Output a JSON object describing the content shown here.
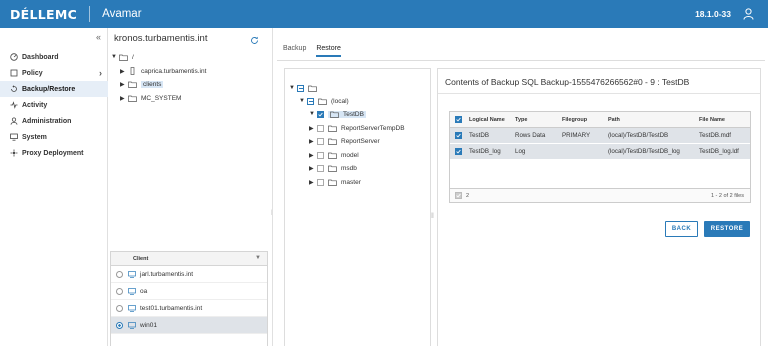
{
  "header": {
    "brand": "DÉLLEMC",
    "app_name": "Avamar",
    "version": "18.1.0-33",
    "bg_color": "#2a7ab8"
  },
  "nav": {
    "collapse_glyph": "«",
    "items": [
      {
        "label": "Dashboard",
        "icon": "dashboard-icon"
      },
      {
        "label": "Policy",
        "icon": "policy-icon"
      },
      {
        "label": "Backup/Restore",
        "icon": "backup-restore-icon",
        "active": true
      },
      {
        "label": "Activity",
        "icon": "activity-icon"
      },
      {
        "label": "Administration",
        "icon": "administration-icon"
      },
      {
        "label": "System",
        "icon": "system-icon"
      },
      {
        "label": "Proxy Deployment",
        "icon": "proxy-deployment-icon"
      }
    ]
  },
  "domain_tree": {
    "hostname": "kronos.turbamentis.int",
    "root": "/",
    "children": [
      "caprica.turbamentis.int",
      "clients",
      "MC_SYSTEM"
    ]
  },
  "client_table": {
    "header": "Client",
    "rows": [
      "jarl.turbamentis.int",
      "oa",
      "test01.turbamentis.int",
      "win01"
    ],
    "selected_index": 3
  },
  "tabs": [
    "Backup",
    "Restore"
  ],
  "active_tab": "Restore",
  "db_tree": {
    "instance": "(local)",
    "databases": [
      "TestDB",
      "ReportServerTempDB",
      "ReportServer",
      "model",
      "msdb",
      "master"
    ]
  },
  "contents": {
    "title": "Contents of Backup SQL Backup-1555476266562#0 - 9 : TestDB",
    "columns": [
      "Logical Name",
      "Type",
      "Filegroup",
      "Path",
      "File Name"
    ],
    "rows": [
      [
        "TestDB",
        "Rows Data",
        "PRIMARY",
        "(local)/TestDB/TestDB",
        "TestDB.mdf"
      ],
      [
        "TestDB_log",
        "Log",
        "",
        "(local)/TestDB/TestDB_log",
        "TestDB_log.ldf"
      ]
    ],
    "footer_count": "2",
    "footer_range": "1 - 2 of 2 files",
    "back_label": "BACK",
    "restore_label": "RESTORE"
  }
}
